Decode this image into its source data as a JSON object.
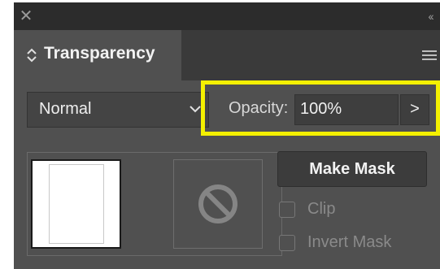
{
  "titlebar": {
    "close_glyph": "✕",
    "collapse_glyph": "‹‹"
  },
  "panel": {
    "tab_label": "Transparency",
    "tab_icon": "updown-arrows-icon",
    "menu_icon": "hamburger-menu-icon"
  },
  "blend": {
    "value": "Normal",
    "chevron_icon": "chevron-down-icon"
  },
  "opacity": {
    "label": "Opacity:",
    "value": "100%",
    "stepper_glyph": ">",
    "highlight_color": "#f4f000"
  },
  "mask": {
    "empty_icon": "no-mask-icon",
    "make_mask_label": "Make Mask",
    "clip_label": "Clip",
    "invert_mask_label": "Invert Mask"
  },
  "colors": {
    "panel_bg": "#505050",
    "titlebar_bg": "#2c2c2c"
  }
}
